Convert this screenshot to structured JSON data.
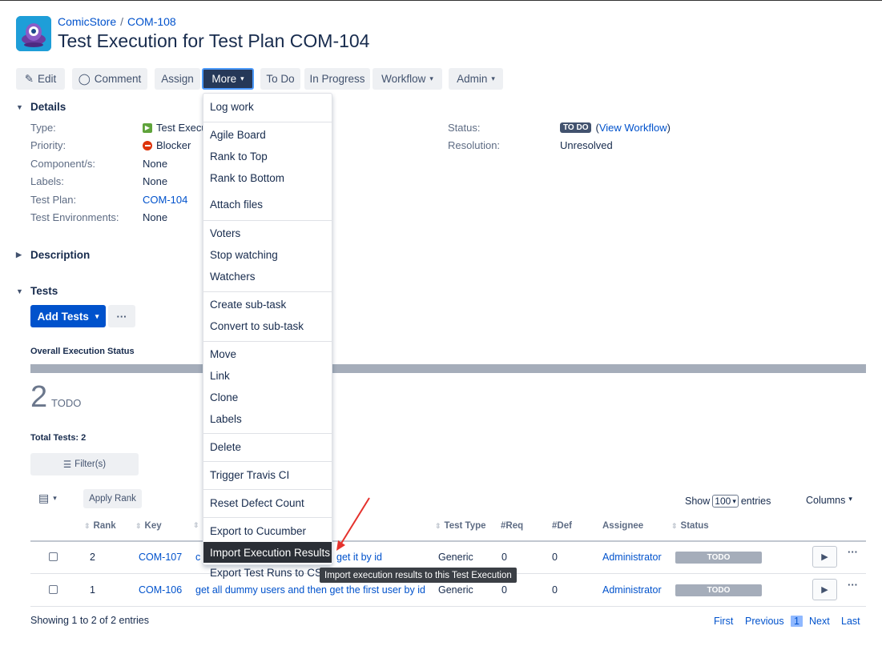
{
  "breadcrumb": {
    "project": "ComicStore",
    "separator": "/",
    "issue_key": "COM-108"
  },
  "title": "Test Execution for Test Plan COM-104",
  "toolbar": {
    "edit": "Edit",
    "comment": "Comment",
    "assign": "Assign",
    "more": "More",
    "todo": "To Do",
    "in_progress": "In Progress",
    "workflow": "Workflow",
    "admin": "Admin"
  },
  "details": {
    "heading": "Details",
    "type_label": "Type:",
    "type_value": "Test Execu",
    "priority_label": "Priority:",
    "priority_value": "Blocker",
    "components_label": "Component/s:",
    "components_value": "None",
    "labels_label": "Labels:",
    "labels_value": "None",
    "test_plan_label": "Test Plan:",
    "test_plan_value": "COM-104",
    "test_env_label": "Test Environments:",
    "test_env_value": "None",
    "status_label": "Status:",
    "status_value": "TO DO",
    "view_workflow": "View Workflow",
    "resolution_label": "Resolution:",
    "resolution_value": "Unresolved"
  },
  "description": {
    "heading": "Description"
  },
  "tests": {
    "heading": "Tests",
    "add_tests": "Add Tests",
    "more_actions": "···",
    "overall_status": "Overall Execution Status",
    "count": "2",
    "count_label": "TODO",
    "total": "Total Tests: 2",
    "filter": "Filter(s)",
    "apply_rank": "Apply Rank",
    "show": "Show",
    "entries_select": "100",
    "entries": "entries",
    "columns": "Columns",
    "headers": {
      "rank": "Rank",
      "key": "Key",
      "test_type": "Test Type",
      "req": "#Req",
      "def": "#Def",
      "assignee": "Assignee",
      "status": "Status"
    },
    "rows": [
      {
        "rank": "2",
        "key": "COM-107",
        "summary_start": "c",
        "summary_end": "get it by id",
        "type": "Generic",
        "req": "0",
        "def": "0",
        "assignee": "Administrator",
        "status": "TODO"
      },
      {
        "rank": "1",
        "key": "COM-106",
        "summary": "get all dummy users and then get the first user by id",
        "type": "Generic",
        "req": "0",
        "def": "0",
        "assignee": "Administrator",
        "status": "TODO"
      }
    ],
    "showing": "Showing 1 to 2 of 2 entries",
    "pagination": {
      "first": "First",
      "previous": "Previous",
      "current": "1",
      "next": "Next",
      "last": "Last"
    }
  },
  "more_menu": {
    "groups": [
      [
        "Log work"
      ],
      [
        "Agile Board",
        "Rank to Top",
        "Rank to Bottom",
        "Attach files"
      ],
      [
        "Voters",
        "Stop watching",
        "Watchers"
      ],
      [
        "Create sub-task",
        "Convert to sub-task"
      ],
      [
        "Move",
        "Link",
        "Clone",
        "Labels"
      ],
      [
        "Delete"
      ],
      [
        "Trigger Travis CI"
      ],
      [
        "Reset Defect Count"
      ],
      [
        "Export to Cucumber",
        "Import Execution Results",
        "Export Test Runs to CSV"
      ]
    ],
    "highlighted": "Import Execution Results"
  },
  "tooltip": "Import execution results to this Test Execution",
  "colors": {
    "primary": "#0052cc",
    "more_button": "#253858",
    "todo_gray": "#a5adba",
    "annotation_arrow": "#e5322d"
  }
}
